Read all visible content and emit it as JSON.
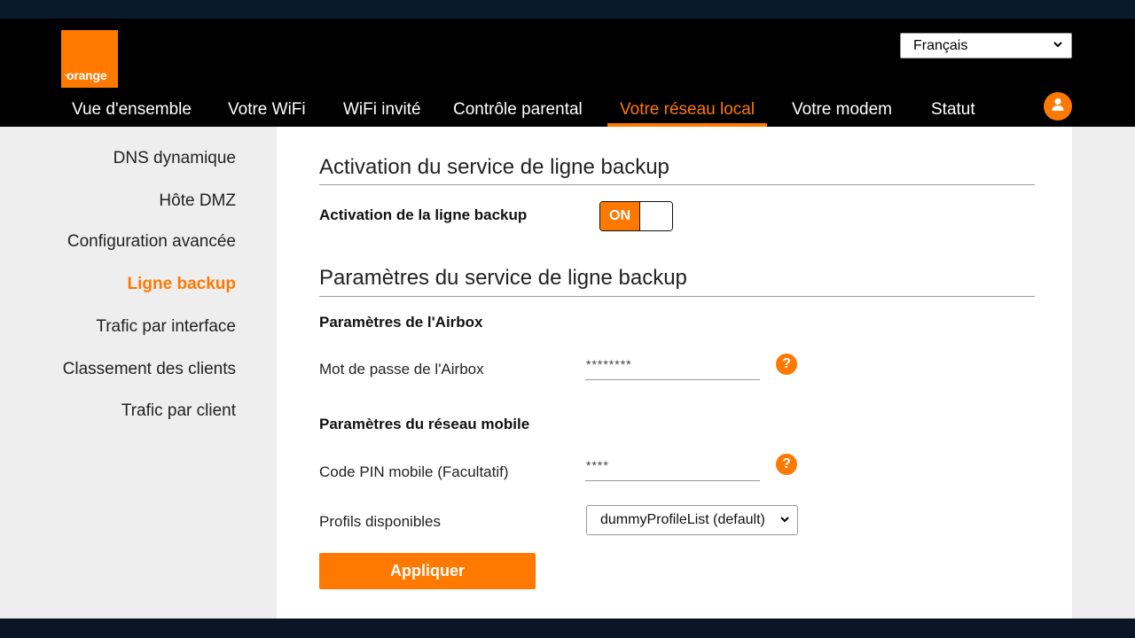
{
  "brand": {
    "logo_text": "orange",
    "trademark": "™",
    "accent": "#ff7900"
  },
  "language": {
    "selected": "Français"
  },
  "nav": {
    "items": [
      {
        "label": "Vue d'ensemble"
      },
      {
        "label": "Votre WiFi"
      },
      {
        "label": "WiFi invité"
      },
      {
        "label": "Contrôle parental"
      },
      {
        "label": "Votre réseau local"
      },
      {
        "label": "Votre modem"
      },
      {
        "label": "Statut"
      }
    ],
    "active": "Votre réseau local",
    "user_icon": "user-icon"
  },
  "sidebar": {
    "items": [
      {
        "label": "DNS dynamique"
      },
      {
        "label": "Hôte DMZ"
      },
      {
        "label": "Configuration avancée"
      },
      {
        "label": "Ligne backup"
      },
      {
        "label": "Trafic par interface"
      },
      {
        "label": "Classement des clients"
      },
      {
        "label": "Trafic par client"
      }
    ],
    "active": "Ligne backup"
  },
  "main": {
    "section1_title": "Activation du service de ligne backup",
    "activation_label": "Activation de la ligne backup",
    "toggle_label": "ON",
    "section2_title": "Paramètres du service de ligne backup",
    "airbox_heading": "Paramètres de l'Airbox",
    "airbox_password_label": "Mot de passe de l'Airbox",
    "airbox_password_value": "********",
    "mobile_heading": "Paramètres du réseau mobile",
    "pin_label": "Code PIN mobile (Facultatif)",
    "pin_value": "****",
    "profiles_label": "Profils disponibles",
    "profiles_selected": "dummyProfileList (default)",
    "help_glyph": "?",
    "apply_label": "Appliquer"
  }
}
